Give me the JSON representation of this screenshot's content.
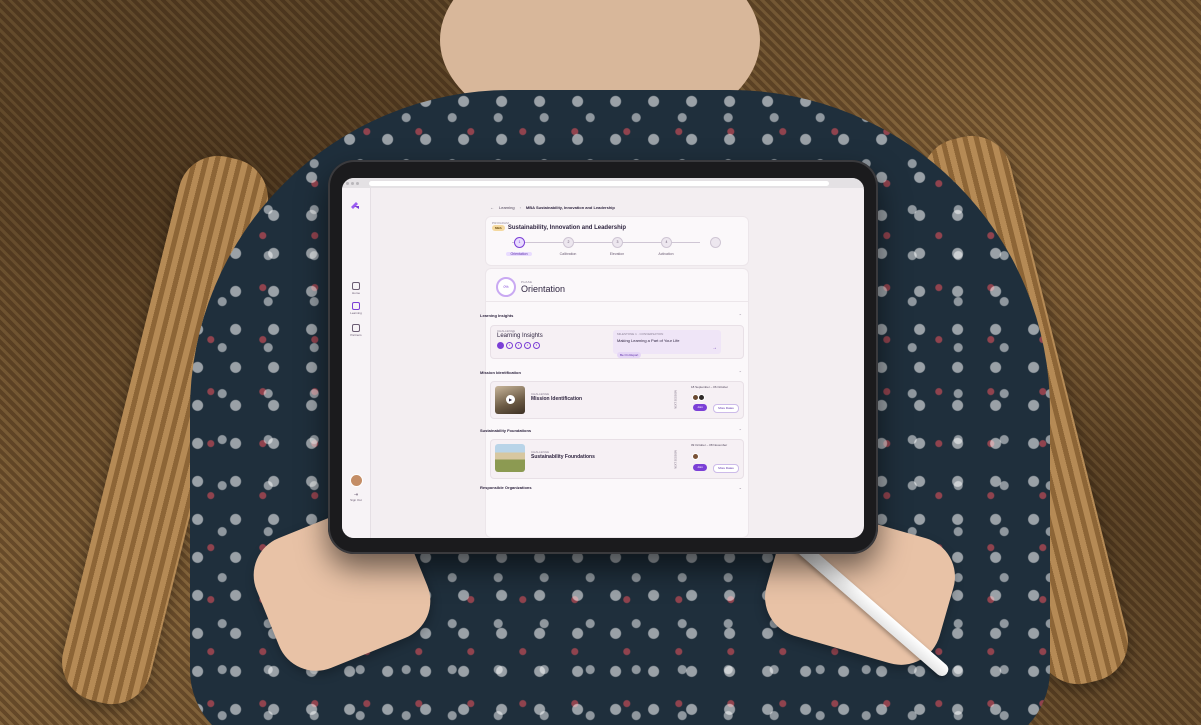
{
  "sidebar": {
    "items": [
      {
        "label": "Home",
        "icon": "home-icon"
      },
      {
        "label": "Learning",
        "icon": "learning-icon"
      },
      {
        "label": "Partners",
        "icon": "partners-icon"
      }
    ],
    "sign_out": "Sign Out"
  },
  "breadcrumb": {
    "back_icon": "arrow-left-icon",
    "items": [
      "Learning",
      "MBA Sustainability, Innovation and Leadership"
    ]
  },
  "program": {
    "label": "PROGRAM",
    "badge": "MBA",
    "title": "Sustainability, Innovation and Leadership",
    "steps": [
      {
        "number": "1",
        "label": "Orientation",
        "active": true
      },
      {
        "number": "2",
        "label": "Calibration",
        "active": false
      },
      {
        "number": "3",
        "label": "Elevation",
        "active": false
      },
      {
        "number": "4",
        "label": "Activation",
        "active": false
      },
      {
        "number": "",
        "label": "",
        "active": false
      }
    ]
  },
  "phase": {
    "progress": "0%",
    "label": "PHASE",
    "title": "Orientation"
  },
  "sections": {
    "learning_insights": {
      "heading": "Learning Insights",
      "challenge_label": "CHALLENGE",
      "challenge_title": "Learning Insights",
      "dots": [
        "1",
        "2",
        "3",
        "4",
        "5"
      ],
      "panel_meta": "MILESTONE 1 · CONVERSATION",
      "panel_title": "Making Learning a Part of Your Life",
      "panel_tag": "Be On Report"
    },
    "mission": {
      "heading": "Mission Identification",
      "label": "CHALLENGE",
      "title": "Mission Identification",
      "vertical": "NEXT SESSION",
      "date": "18 September – 06 October",
      "join": "Join",
      "more": "More Dates"
    },
    "foundations": {
      "heading": "Sustainability Foundations",
      "label": "CHALLENGE",
      "title": "Sustainability Foundations",
      "vertical": "NEXT SESSION",
      "date": "09 October – 08 November",
      "join": "Join",
      "more": "More Dates"
    },
    "responsible": {
      "heading": "Responsible Organizations"
    }
  },
  "colors": {
    "accent": "#7b3fd6",
    "text": "#2f2540",
    "card": "#fbf8fa"
  }
}
